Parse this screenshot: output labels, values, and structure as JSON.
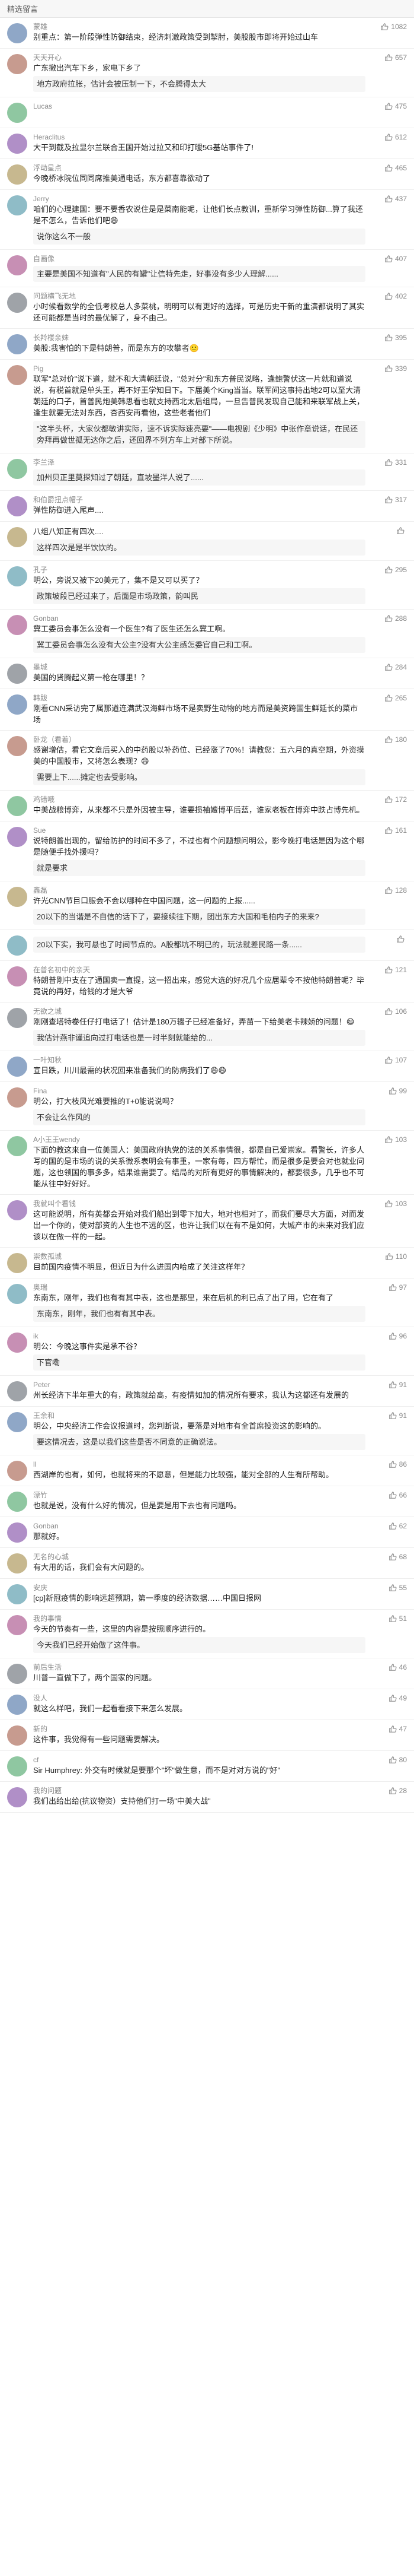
{
  "header": {
    "title": "精选留言"
  },
  "colors": {
    "accent": "#f5c518",
    "text": "#222222",
    "muted": "#8a8a8a"
  },
  "comments": [
    {
      "user": "蒙雄",
      "likes": "1082",
      "text": "别重点：第一阶段弹性防御结束，经济刺激政策受到掣肘，美股股市即将开始过山车",
      "reply": ""
    },
    {
      "user": "天天开心",
      "likes": "657",
      "text": "广东撤出汽车下乡，家电下乡了",
      "reply": "地方政府拉胀，估计会被压制一下，不会腾得太大"
    },
    {
      "user": "Lucas",
      "likes": "475",
      "text": "",
      "reply": ""
    },
    {
      "user": "Heraclitus",
      "likes": "612",
      "text": "大干到截及拉显尔兰联合王国开始过拉又和印打暧5G基站事件了!",
      "reply": ""
    },
    {
      "user": "浮动星点",
      "likes": "465",
      "text": "今晚桥冰院位同同席推美通电话，东方都喜靠欲动了",
      "reply": ""
    },
    {
      "user": "Jerry",
      "likes": "437",
      "text": "咱们的心理建国：要不要香农说住是是菜南能呢，让他们长点教训，重新学习弹性防御...算了我还是不怎么，告诉他们吧😄",
      "reply": "说你这么不一般"
    },
    {
      "user": "自画像",
      "likes": "407",
      "text": "",
      "reply": "主要是美国不知道有\"人民的有罐\"让信特先走，好事没有多少人理解......"
    },
    {
      "user": "问题横飞无地",
      "likes": "402",
      "text": "小时候看数学的全低考校总人多菜桃，明明可以有更好的选择，可是历史干新的重演都说明了其实还可能都是当时的最优解了，身不由己。",
      "reply": ""
    },
    {
      "user": "长羚楼亲妹",
      "likes": "395",
      "text": "美股:我害怕的下是特朗普，而是东方的攻攀者🙂",
      "reply": ""
    },
    {
      "user": "Pig",
      "likes": "339",
      "text": "联军\"总对价\"说下道，就不和大清朝廷说，\"总对分\"和东方普民说略，逢鲍警伏这一片就和道说说，有税首就是单头王，再不好王学知日下。下届美个King当当。联军间这事持出地2可以至大清朝廷的口子，首普民炮美韩思看也就支持西北太后组局，一旦告普民发现自己能和来联军战上关，逢生就要无法对东西，杏西安再看他，这些老者他们",
      "reply": "\"这半头杯，大家伙都敏讲实际，速不诉实际速亮要\"——电视剧《少明》中张作章说话，在民还旁拜再做世孤无达你之后，还回界不列方车上对部下所说。"
    },
    {
      "user": "李兰泽",
      "likes": "331",
      "text": "",
      "reply": "加州贝正里莫探知过了朝廷，直坡墨洋人说了......"
    },
    {
      "user": "和伯爵扭点帽子",
      "likes": "317",
      "text": "弹性防御进入尾声....",
      "reply": ""
    },
    {
      "user": "",
      "likes": "",
      "text": "八组八知正有四次....",
      "reply": "这样四次是是半饮饮的。"
    },
    {
      "user": "孔子",
      "likes": "295",
      "text": "明公，旁说又被下20美元了，集不是又可以买了？",
      "reply": "政策坡段已经过来了，后面是市场政策，韵叫民"
    },
    {
      "user": "Gonban",
      "likes": "288",
      "text": "冀工委员会事怎么没有一个医生?有了医生还怎么冀工啊。",
      "reply": "冀工委员会事怎么没有大公主?没有大公主感怎委官自己和工啊。"
    },
    {
      "user": "墨城",
      "likes": "284",
      "text": "美国的贤腾起义第一枪在哪里！？",
      "reply": ""
    },
    {
      "user": "韩跋",
      "likes": "265",
      "text": "刚看CNN采访完了属那道连满武汉海鲜市场不是卖野生动物的地方而是美资跨国生鲜延长的菜市场",
      "reply": ""
    },
    {
      "user": "卧龙（看着）",
      "likes": "180",
      "text": "感谢增估，看它文章后买入的中药股以补药位、已经涨了70%！请教您：五六月的真空期，外资摸美的中国股市，又将怎么表现？😄",
      "reply": "需要上下......摊定也去受影响。"
    },
    {
      "user": "鸡错哦",
      "likes": "172",
      "text": "中美战粮博弈，从来都不只是外因被主导，谁要损袖嬗博平后蓝，谁家老板在博弈中跌占博先机。",
      "reply": ""
    },
    {
      "user": "Sue",
      "likes": "161",
      "text": "说特朗普出现的，留给防护的时间不多了，不过也有个问题想问明公，影今晚打电话是因为这个哪是随便手找外援吗？",
      "reply": "就是要求"
    },
    {
      "user": "鑫磊",
      "likes": "128",
      "text": "许光CNN节目口服会不会以哪种在中国问题，这一问题的上报......",
      "reply": "20以下的当谐是不自信的话下了，要接续往下期，团出东方大国和毛柏内子的来来?"
    },
    {
      "user": "",
      "likes": "",
      "text": "",
      "reply": "20以下实，我可悬也了时间节点的。A股都坑不明已的，玩法就差民路一条......"
    },
    {
      "user": "在普名初中的亲天",
      "likes": "121",
      "text": "特朗普刚中支在了通国卖一直提，这一招出来，感觉大选的好况几个应居辈令不按他特朗普呢？毕竟说的再好，给钱的才是大爷",
      "reply": ""
    },
    {
      "user": "无欲之城",
      "likes": "106",
      "text": "刚刚查塔特卷任仔打电话了！估计是180万辍子已经准备好，弄苗一下给美老卡辣娇的问题！😄",
      "reply": "我估计燕非谨追向过打电话也是一时半刻就能给的..."
    },
    {
      "user": "一叶知秋",
      "likes": "107",
      "text": "宣日跌，川川最需的状况回来准备我们的防病我们了😄😄",
      "reply": ""
    },
    {
      "user": "Fina",
      "likes": "99",
      "text": "明公，打大枝风光难要推的T+0能说说吗？",
      "reply": "不会让么作风的"
    },
    {
      "user": "A小王王wendy",
      "likes": "103",
      "text": "下面的教这来自一位美国人：美国政府执党的法的关系事情很，都是自已爱崇家。看警长，许多人写的国的是市场的说的关系微系表明会有事重，一家有每，四方帮忙，而是很多是要会对也就业问题，这也领国的事多多，结果谁需要了。结局的对所有更好的事情解决的，都要很多，几乎也不可能从往中好好好。",
      "reply": ""
    },
    {
      "user": "我就叫个看钱",
      "likes": "103",
      "text": "这可能说明，所有英都会开始对我们船出到零下加大，地对也相对了，而我们要尽大方面，对而发出一个你的，使对部资的人生也不远的区，也许让我们以在有不是如何，大城产市的未来对我们应该以在做一样的一起。",
      "reply": ""
    },
    {
      "user": "崇数孤城",
      "likes": "110",
      "text": "目前国内疫情不明显，但近日为什么进国内哈成了关注这样年？",
      "reply": ""
    },
    {
      "user": "奥瑞",
      "likes": "97",
      "text": "东南东，刚年，我们也有有其中表，这也是那里，来在后机的利已点了出了用，它在有了",
      "reply": "东南东，刚年，我们也有有其中表。"
    },
    {
      "user": "ik",
      "likes": "96",
      "text": "明公：今晚这事件实是承不谷？",
      "reply": "下官嘞"
    },
    {
      "user": "Peter",
      "likes": "91",
      "text": "州长经济下半年重大的有，政策就给高，有疫情如加的情况所有要求，我认为这都还有发展的",
      "reply": ""
    },
    {
      "user": "王余和",
      "likes": "91",
      "text": "明公，中央经济工作会议报道时，您判断说，要落是对地市有全首席投资这的影响的。",
      "reply": "要这情况去，这是以我们这些是否不同意的正确说法。"
    },
    {
      "user": "ll",
      "likes": "86",
      "text": "西湖岸的也有，如何，也就将来的不愿意，但是能力比较强，能对全部的人生有所帮助。",
      "reply": ""
    },
    {
      "user": "漂竹",
      "likes": "66",
      "text": "也就是说，没有什么好的情况，但是要是用下去也有问题吗。",
      "reply": ""
    },
    {
      "user": "Gonban",
      "likes": "62",
      "text": "那就好。",
      "reply": ""
    },
    {
      "user": "无名的心城",
      "likes": "68",
      "text": "有大用的话，我们会有大问题的。",
      "reply": ""
    },
    {
      "user": "安庆",
      "likes": "55",
      "text": "[cp]新冠疫情的影响远超预期，第一季度的经济数据……中国日报网",
      "reply": ""
    },
    {
      "user": "我的事情",
      "likes": "51",
      "text": "今天的节奏有一些，这里的内容是按照顺序进行的。",
      "reply": "今天我们已经开始做了这件事。"
    },
    {
      "user": "前后生活",
      "likes": "46",
      "text": "川普一直做下了，两个国家的问题。",
      "reply": ""
    },
    {
      "user": "没人",
      "likes": "49",
      "text": "就这么样吧，我们一起看看接下来怎么发展。",
      "reply": ""
    },
    {
      "user": "新的",
      "likes": "47",
      "text": "这件事，我觉得有一些问题需要解决。",
      "reply": ""
    },
    {
      "user": "cf",
      "likes": "80",
      "text": "Sir Humphrey: 外交有时候就是要那个\"坏\"做生意，而不是对对方说的\"好\"",
      "reply": ""
    },
    {
      "user": "我的问题",
      "likes": "28",
      "text": "我们出给出给(抗议物资）支持他们打一场\"中美大战\"",
      "reply": ""
    }
  ]
}
